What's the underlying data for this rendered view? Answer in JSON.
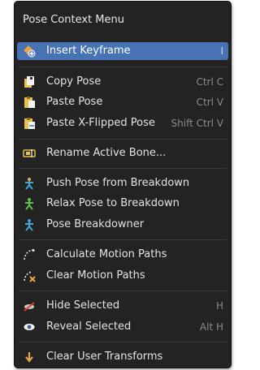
{
  "menu": {
    "title": "Pose Context Menu",
    "items": [
      {
        "label": "Insert Keyframe",
        "shortcut": "I",
        "icon": "keyframe-insert-icon",
        "active": true
      },
      {
        "label": "Copy Pose",
        "shortcut": "Ctrl C",
        "icon": "copy-pose-icon"
      },
      {
        "label": "Paste Pose",
        "shortcut": "Ctrl V",
        "icon": "paste-pose-icon"
      },
      {
        "label": "Paste X-Flipped Pose",
        "shortcut": "Shift Ctrl V",
        "icon": "paste-flipped-pose-icon"
      },
      {
        "label": "Rename Active Bone...",
        "shortcut": "",
        "icon": "rename-bone-icon"
      },
      {
        "label": "Push Pose from Breakdown",
        "shortcut": "",
        "icon": "push-pose-icon"
      },
      {
        "label": "Relax Pose to Breakdown",
        "shortcut": "",
        "icon": "relax-pose-icon"
      },
      {
        "label": "Pose Breakdowner",
        "shortcut": "",
        "icon": "pose-breakdowner-icon"
      },
      {
        "label": "Calculate Motion Paths",
        "shortcut": "",
        "icon": "motion-path-icon"
      },
      {
        "label": "Clear Motion Paths",
        "shortcut": "",
        "icon": "clear-motion-path-icon"
      },
      {
        "label": "Hide Selected",
        "shortcut": "H",
        "icon": "hide-icon"
      },
      {
        "label": "Reveal Selected",
        "shortcut": "Alt H",
        "icon": "reveal-icon"
      },
      {
        "label": "Clear User Transforms",
        "shortcut": "",
        "icon": "clear-transform-icon"
      }
    ]
  },
  "colors": {
    "menu_bg": "#232323",
    "highlight": "#4772b3",
    "text": "#e3e3e3",
    "shortcut": "#8a8a8a"
  }
}
